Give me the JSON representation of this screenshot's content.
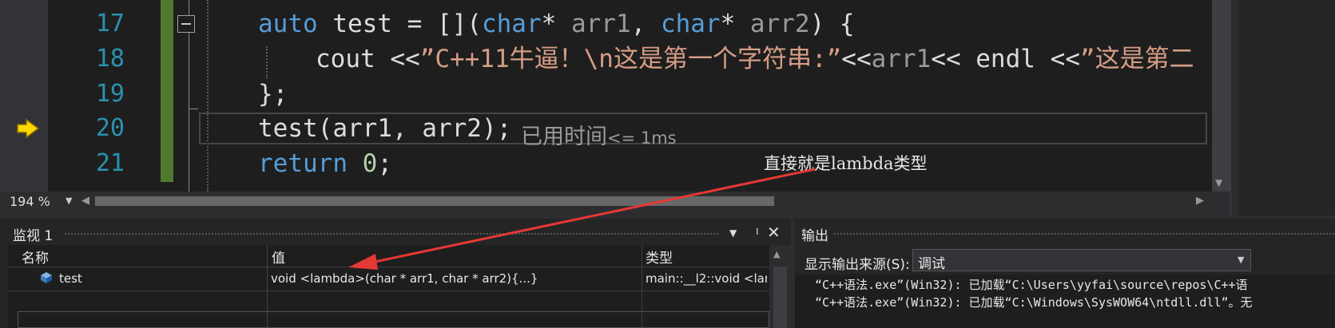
{
  "editor": {
    "line_numbers": [
      "17",
      "18",
      "19",
      "20",
      "21"
    ],
    "lines": {
      "l17": {
        "kw": "auto",
        "ident": " test = [](",
        "type1": "char",
        "star1": "* ",
        "p1": "arr1",
        "sep": ", ",
        "type2": "char",
        "star2": "* ",
        "p2": "arr2",
        "end": ") {"
      },
      "l18": {
        "pre": "cout <<",
        "str1": "”C++11牛逼！\\n这是第一个字符串:”",
        "mid1": "<<",
        "p1": "arr1",
        "mid2": "<< endl <<",
        "str2": "”这是第二"
      },
      "l19": {
        "text": "};"
      },
      "l20": {
        "text": "test(arr1, arr2);"
      },
      "l21": {
        "kw": "return",
        "num": "0",
        "end": ";"
      }
    },
    "elapsed_label": "已用时间",
    "elapsed_value": "<= 1ms",
    "annotation": "直接就是lambda类型",
    "zoom": "194 %"
  },
  "watch": {
    "title": "监视 1",
    "columns": {
      "name": "名称",
      "value": "值",
      "type": "类型"
    },
    "rows": [
      {
        "name": "test",
        "value": "void <lambda>(char * arr1, char * arr2){...}",
        "type": "main::__l2::void <lam"
      }
    ]
  },
  "output": {
    "title": "输出",
    "source_label": "显示输出来源(S):",
    "source_value": "调试",
    "lines": [
      "“C++语法.exe”(Win32): 已加载“C:\\Users\\yyfai\\source\\repos\\C++语",
      "“C++语法.exe”(Win32): 已加载“C:\\Windows\\SysWOW64\\ntdll.dll”。无"
    ]
  },
  "colors": {
    "editor_bg": "#1e1e1e",
    "keyword": "#569cd6",
    "string": "#d69d85",
    "line_number": "#2b91af",
    "change_bar": "#4f7a2e",
    "annotation_arrow": "#e53935",
    "breakpoint_arrow": "#ffd800"
  }
}
